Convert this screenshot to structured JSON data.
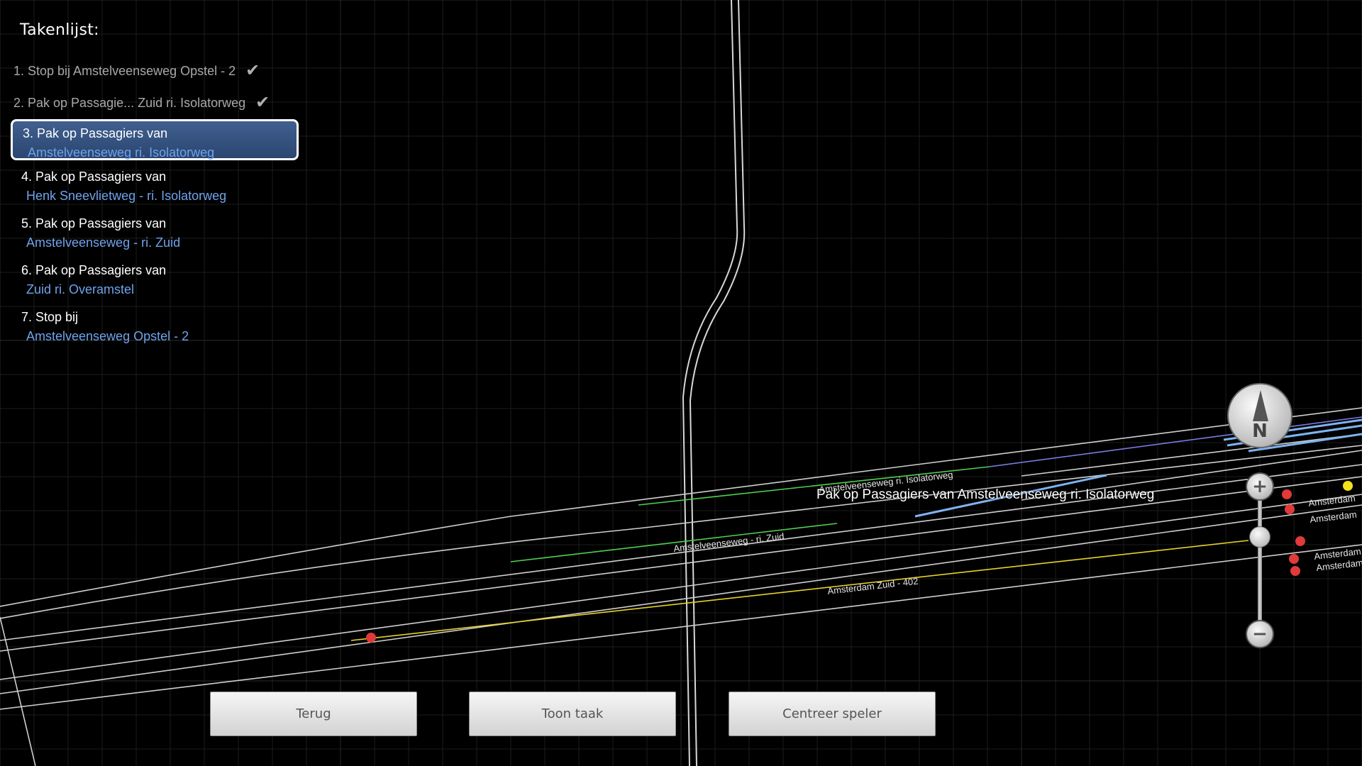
{
  "task_panel": {
    "title": "Takenlijst:",
    "done_tasks": [
      {
        "label": "1. Stop bij  Amstelveenseweg Opstel - 2",
        "icon": "checkmark-icon"
      },
      {
        "label": "2. Pak op Passagie... Zuid ri. Isolatorweg",
        "icon": "checkmark-icon"
      }
    ],
    "tasks": [
      {
        "line1": "3. Pak op Passagiers van",
        "line2": "Amstelveenseweg ri. Isolatorweg",
        "active": true
      },
      {
        "line1": "4. Pak op Passagiers van",
        "line2": "Henk Sneevlietweg - ri. Isolatorweg"
      },
      {
        "line1": "5. Pak op Passagiers van",
        "line2": "Amstelveenseweg - ri. Zuid"
      },
      {
        "line1": "6. Pak op Passagiers van",
        "line2": "Zuid ri. Overamstel"
      },
      {
        "line1": "7. Stop bij",
        "line2": "Amstelveenseweg Opstel - 2"
      }
    ]
  },
  "map": {
    "main_label": "Pak op Passagiers van Amstelveenseweg ri. Isolatorweg",
    "track_labels": {
      "isolatorweg": "Amstelveenseweg ri. Isolatorweg",
      "zuid": "Amstelveenseweg - ri. Zuid",
      "amsterdam_zuid_402": "Amsterdam Zuid - 402",
      "edge1": "Amsterdam",
      "edge2": "Amsterdam",
      "edge3": "Amsterdam",
      "edge4": "Amsterdam"
    },
    "colors": {
      "background": "#000000",
      "grid": "#1c1c1c",
      "track": "#d8d8d8",
      "route_green": "#4fd04f",
      "route_yellow": "#e6d22a",
      "signal_red": "#e03a3a",
      "signal_yellow": "#f2e21a",
      "platform_blue": "#7fb3f0"
    },
    "compass": {
      "label": "N",
      "icon": "compass-icon"
    },
    "zoom": {
      "in_icon": "plus-icon",
      "out_icon": "minus-icon"
    }
  },
  "buttons": {
    "back": "Terug",
    "show_task": "Toon taak",
    "center_player": "Centreer speler"
  }
}
